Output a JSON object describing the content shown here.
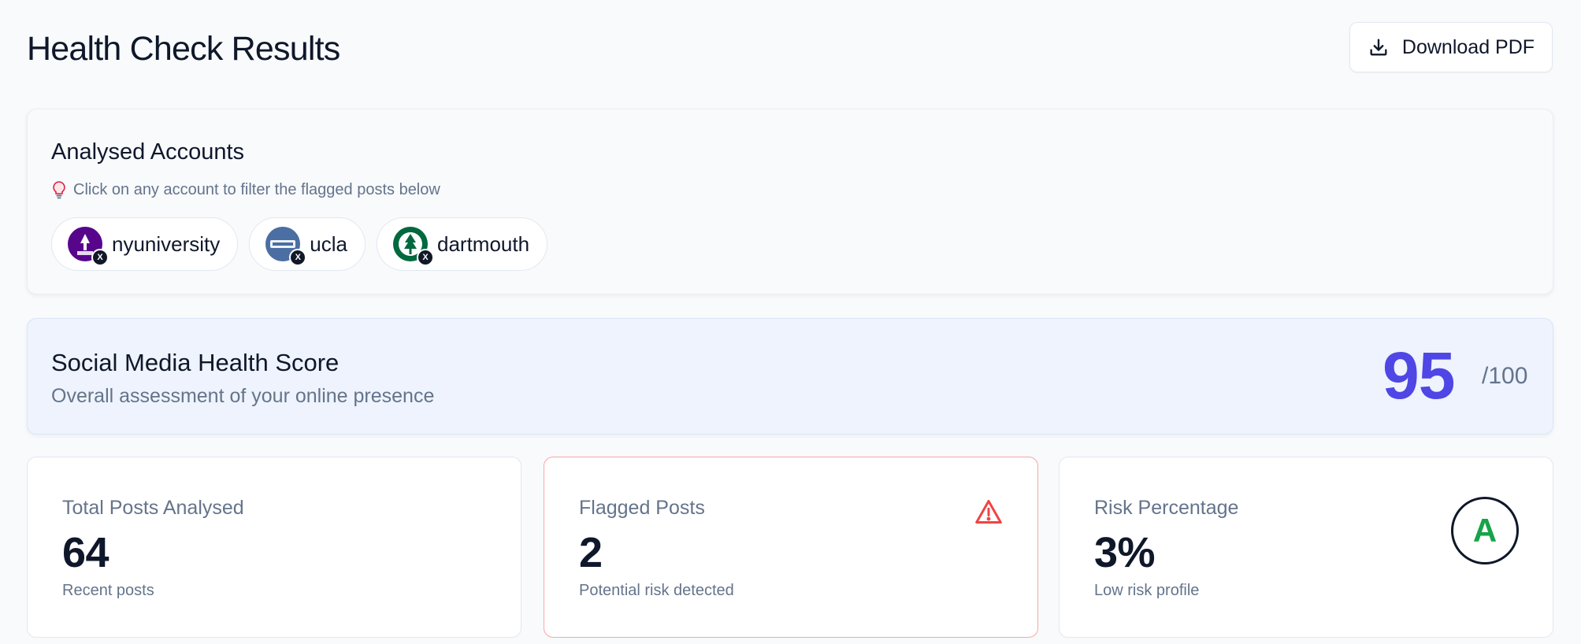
{
  "page": {
    "title": "Health Check Results"
  },
  "toolbar": {
    "download_label": "Download PDF",
    "download_icon": "download-icon"
  },
  "accounts": {
    "title": "Analysed Accounts",
    "hint": "Click on any account to filter the flagged posts below",
    "hint_icon": "lightbulb-icon",
    "items": [
      {
        "handle": "nyuniversity",
        "platform": "X",
        "avatar_color": "#57068c"
      },
      {
        "handle": "ucla",
        "platform": "X",
        "avatar_color": "#2d68c4"
      },
      {
        "handle": "dartmouth",
        "platform": "X",
        "avatar_color": "#00693e"
      }
    ]
  },
  "health_score": {
    "title": "Social Media Health Score",
    "subtitle": "Overall assessment of your online presence",
    "score": "95",
    "max": "/100",
    "score_color": "#4f46e5"
  },
  "stats": [
    {
      "label": "Total Posts Analysed",
      "value": "64",
      "note": "Recent posts"
    },
    {
      "label": "Flagged Posts",
      "value": "2",
      "note": "Potential risk detected",
      "icon": "warning-icon",
      "accent": "#ef4444"
    },
    {
      "label": "Risk Percentage",
      "value": "3%",
      "note": "Low risk profile",
      "grade": "A",
      "grade_color": "#16a34a"
    }
  ]
}
